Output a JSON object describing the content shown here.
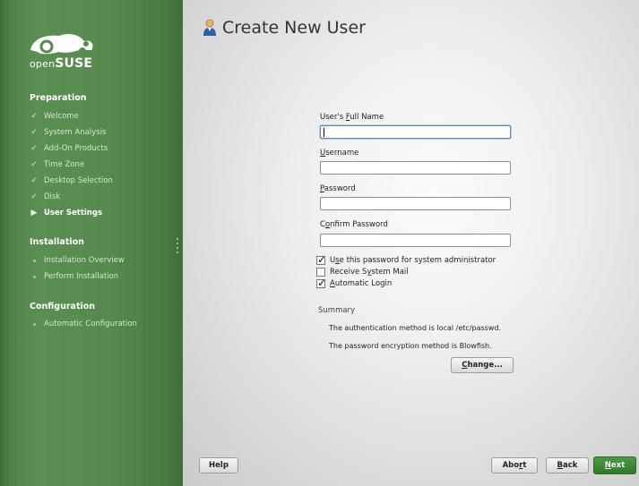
{
  "sidebar": {
    "logo_text_1": "open",
    "logo_text_2": "SUSE",
    "sections": [
      {
        "title": "Preparation",
        "steps": [
          {
            "label": "Welcome",
            "state": "done"
          },
          {
            "label": "System Analysis",
            "state": "done"
          },
          {
            "label": "Add-On Products",
            "state": "done"
          },
          {
            "label": "Time Zone",
            "state": "done"
          },
          {
            "label": "Desktop Selection",
            "state": "done"
          },
          {
            "label": "Disk",
            "state": "done"
          },
          {
            "label": "User Settings",
            "state": "current"
          }
        ]
      },
      {
        "title": "Installation",
        "steps": [
          {
            "label": "Installation Overview",
            "state": "pending"
          },
          {
            "label": "Perform Installation",
            "state": "pending"
          }
        ]
      },
      {
        "title": "Configuration",
        "steps": [
          {
            "label": "Automatic Configuration",
            "state": "pending"
          }
        ]
      }
    ]
  },
  "dialog": {
    "title": "Create New User",
    "title_icon": "user-icon",
    "fields": {
      "full_name": {
        "label_pre": "User's ",
        "label_key": "F",
        "label_post": "ull Name",
        "value": ""
      },
      "username": {
        "label_pre": "",
        "label_key": "U",
        "label_post": "sername",
        "value": ""
      },
      "password": {
        "label_pre": "",
        "label_key": "P",
        "label_post": "assword",
        "value": ""
      },
      "confirm": {
        "label_pre": "C",
        "label_key": "o",
        "label_post": "nfirm Password",
        "value": ""
      }
    },
    "checkboxes": {
      "use_for_admin": {
        "label_pre": "U",
        "label_key": "s",
        "label_post": "e this password for system administrator",
        "checked": true
      },
      "receive_mail": {
        "label_pre": "Receive S",
        "label_key": "y",
        "label_post": "stem Mail",
        "checked": false
      },
      "auto_login": {
        "label_pre": "",
        "label_key": "A",
        "label_post": "utomatic Login",
        "checked": true
      }
    },
    "summary": {
      "title": "Summary",
      "line1": "The authentication method is local /etc/passwd.",
      "line2": "The password encryption method is Blowfish.",
      "change_pre": "",
      "change_key": "C",
      "change_post": "hange..."
    }
  },
  "footer": {
    "help": "Help",
    "abort_pre": "Abo",
    "abort_key": "r",
    "abort_post": "t",
    "back_pre": "",
    "back_key": "B",
    "back_post": "ack",
    "next_pre": "",
    "next_key": "N",
    "next_post": "ext"
  },
  "colors": {
    "sidebar_green": "#578a4f",
    "next_button": "#3e8a36",
    "focus_border": "#5a8ac7"
  }
}
